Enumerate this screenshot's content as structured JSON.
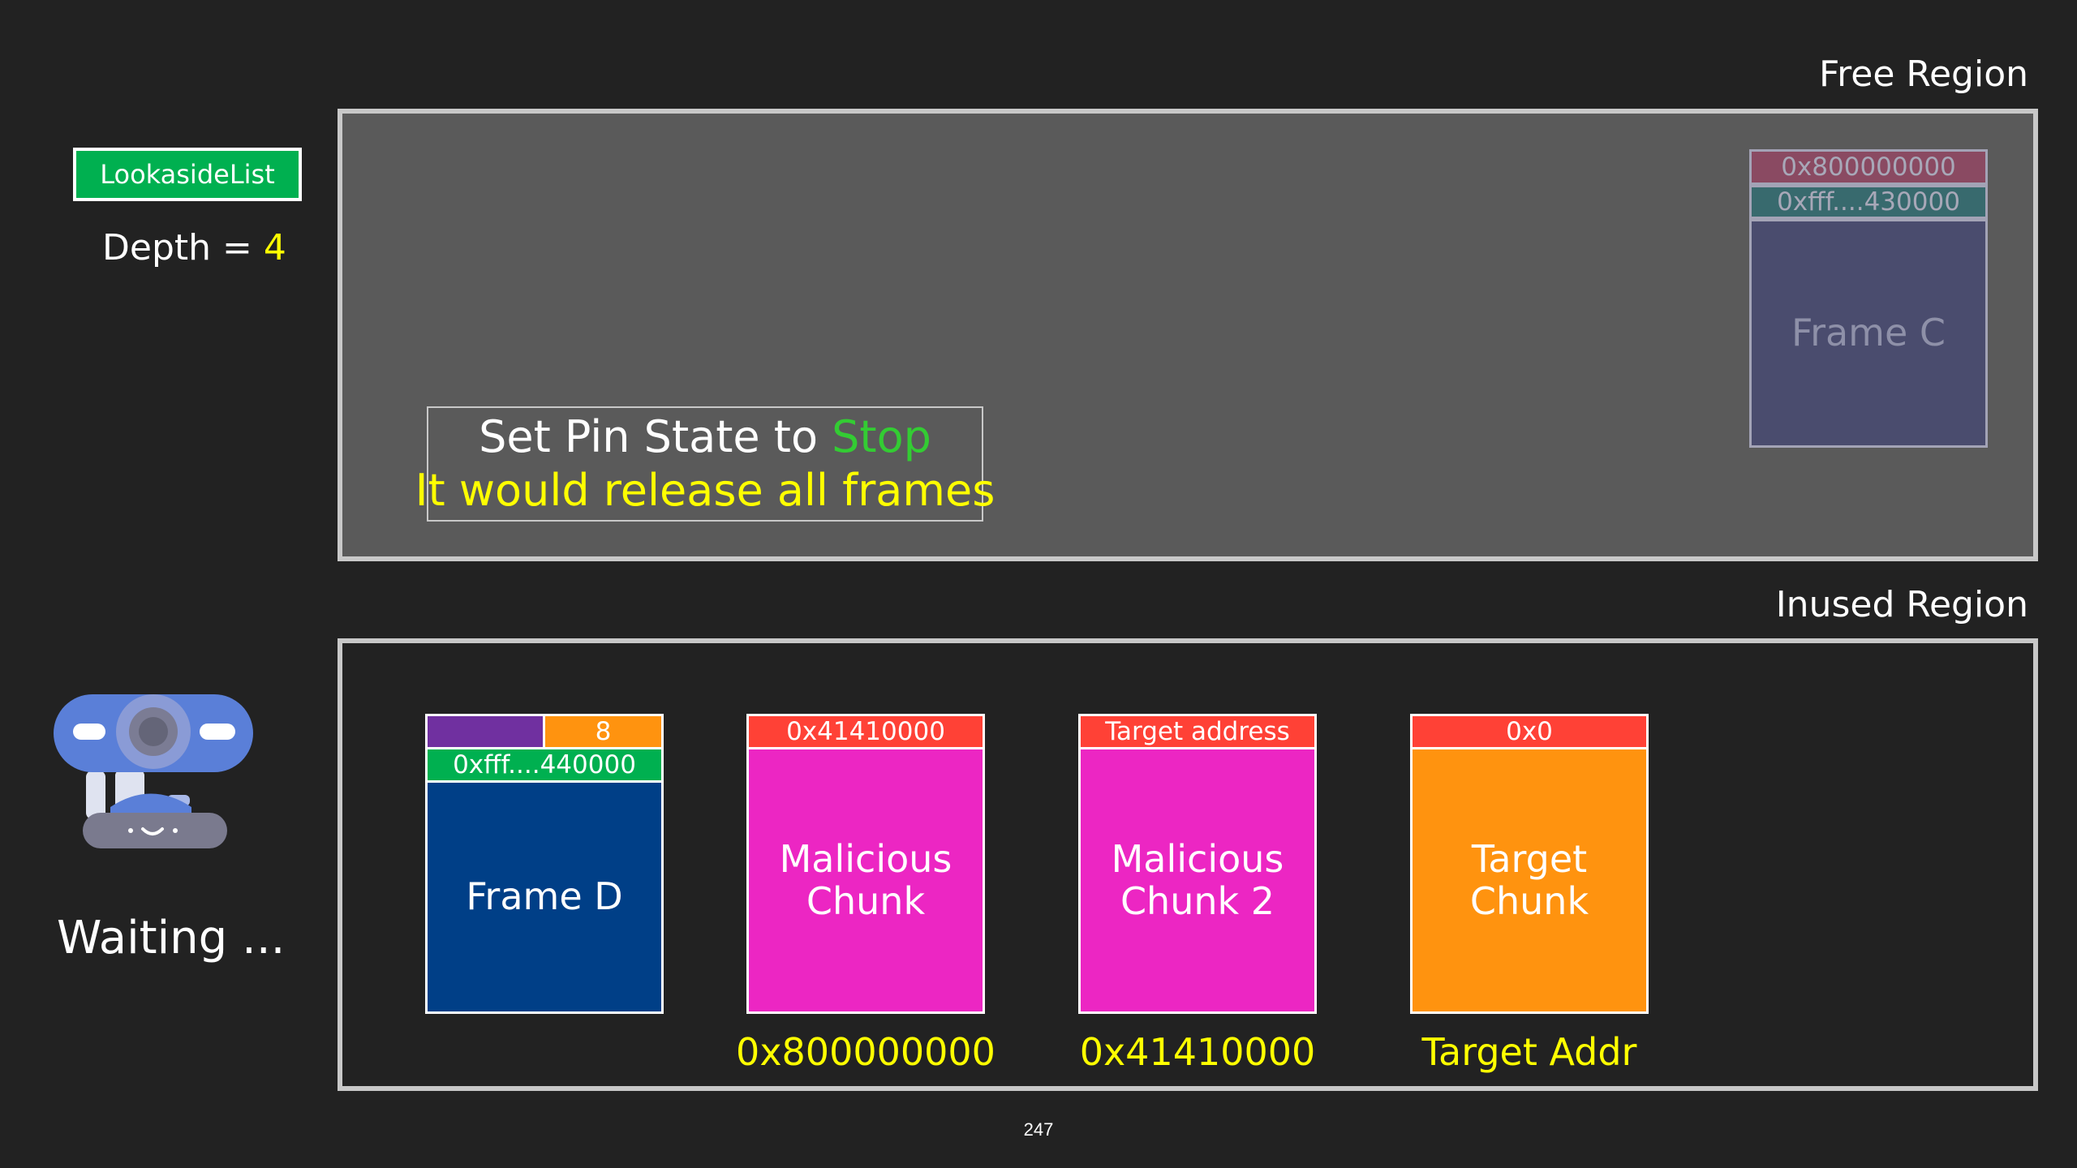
{
  "regions": {
    "free_label": "Free Region",
    "inused_label": "Inused Region"
  },
  "lookaside": {
    "label": "LookasideList",
    "depth_label": "Depth = ",
    "depth_value": "4"
  },
  "status": {
    "waiting": "Waiting ..."
  },
  "callout": {
    "line1_prefix": "Set Pin State to ",
    "line1_highlight": "Stop",
    "line2": "It would release all frames"
  },
  "frame_c": {
    "header_top": "0x800000000",
    "header_bottom": "0xfff....430000",
    "label": "Frame C"
  },
  "frame_d": {
    "header_right": "8",
    "header_bottom": "0xfff....440000",
    "label": "Frame D"
  },
  "chunks": [
    {
      "header": "0x41410000",
      "label": "Malicious Chunk",
      "address": "0x800000000"
    },
    {
      "header": "Target address",
      "label": "Malicious Chunk 2",
      "address": "0x41410000"
    },
    {
      "header": "0x0",
      "label": "Target Chunk",
      "address": "Target Addr"
    }
  ],
  "page_number": "247",
  "colors": {
    "background": "#222222",
    "free_region_fill": "#5a5a5a",
    "lookaside_green": "#00b050",
    "highlight_yellow": "#ffff00",
    "stop_green": "#33cc33",
    "frame_d_blue": "#003f87",
    "chunk_magenta": "#ec26c3",
    "target_orange": "#ff930f",
    "header_red": "#ff4136",
    "header_purple": "#7030a0",
    "frame_c_fill": "#4a4c6e"
  }
}
